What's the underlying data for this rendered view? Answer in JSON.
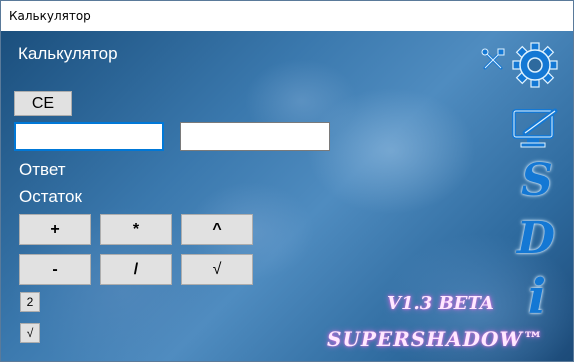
{
  "window": {
    "title": "Калькулятор"
  },
  "header": {
    "title": "Калькулятор"
  },
  "controls": {
    "clear_label": "CE",
    "input_a": {
      "value": "",
      "placeholder": ""
    },
    "input_b": {
      "value": "",
      "placeholder": ""
    }
  },
  "results": {
    "answer_label": "Ответ",
    "remainder_label": "Остаток"
  },
  "operations": {
    "plus": "+",
    "multiply": "*",
    "power": "^",
    "minus": "-",
    "divide": "/",
    "sqrt": "√"
  },
  "small_buttons": {
    "square": "2",
    "root": "√"
  },
  "side_icons": {
    "tools": "tools-icon",
    "settings": "gear-icon",
    "edit": "monitor-pen-icon",
    "s": "S",
    "d": "D",
    "info": "i"
  },
  "branding": {
    "version": "V1.3 BETA",
    "name": "SUPERSHADOW™"
  },
  "colors": {
    "accent": "#0078d7",
    "icon_blue": "#1478d4",
    "brand_glow": "#d070e0"
  }
}
